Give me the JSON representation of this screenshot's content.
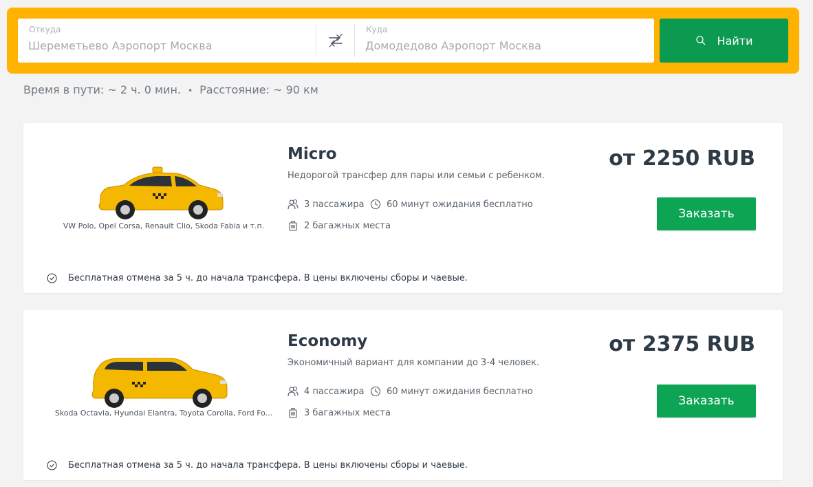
{
  "search": {
    "from_label": "Откуда",
    "from_placeholder": "Шереметьево Аэропорт Москва",
    "to_label": "Куда",
    "to_placeholder": "Домодедово Аэропорт Москва",
    "button_label": "Найти"
  },
  "trip": {
    "duration": "Время в пути: ~ 2 ч. 0 мин.",
    "separator": "•",
    "distance": "Расстояние: ~ 90 км"
  },
  "cards": [
    {
      "title": "Micro",
      "description": "Недорогой трансфер для пары или семьи с ребенком.",
      "passengers": "3 пассажира",
      "waiting": "60 минут ожидания бесплатно",
      "luggage": "2 багажных места",
      "cars": "VW Polo, Opel Corsa, Renault Clio, Skoda Fabia и т.п.",
      "price": "от 2250 RUB",
      "order_label": "Заказать",
      "cancel_note": "Бесплатная отмена за 5 ч. до начала трансфера. В цены включены сборы и чаевые."
    },
    {
      "title": "Economy",
      "description": "Экономичный вариант для компании до 3-4 человек.",
      "passengers": "4 пассажира",
      "waiting": "60 минут ожидания бесплатно",
      "luggage": "3 багажных места",
      "cars": "Skoda Octavia, Hyundai Elantra, Toyota Corolla, Ford Fo...",
      "price": "от 2375 RUB",
      "order_label": "Заказать",
      "cancel_note": "Бесплатная отмена за 5 ч. до начала трансфера. В цены включены сборы и чаевые."
    }
  ],
  "colors": {
    "search_bar": "#ffb300",
    "search_button": "#0b9a4f",
    "order_button": "#0da554",
    "taxi_body": "#f5b800"
  }
}
